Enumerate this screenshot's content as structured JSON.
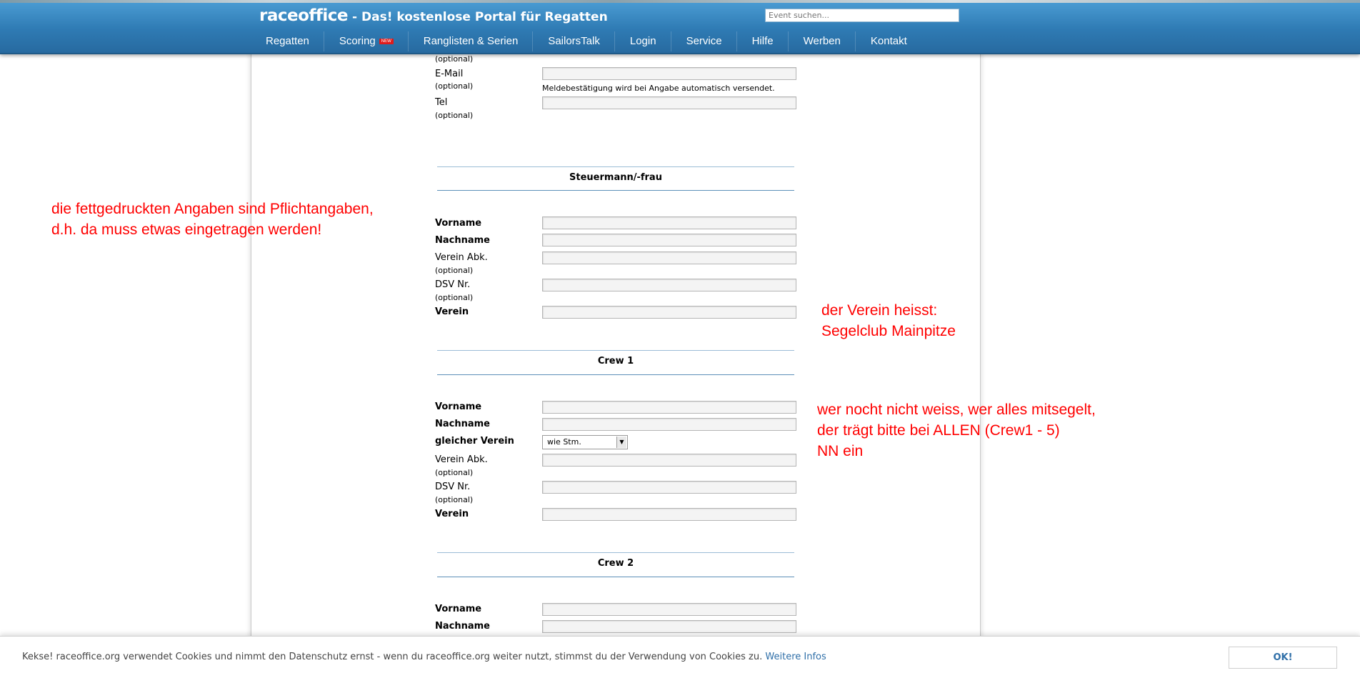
{
  "header": {
    "logo_brand": "raceoffice",
    "logo_tagline": "- Das! kostenlose Portal für Regatten",
    "search_placeholder": "Event suchen...",
    "nav": [
      {
        "label": "Regatten"
      },
      {
        "label": "Scoring",
        "badge": "NEW"
      },
      {
        "label": "Ranglisten & Serien"
      },
      {
        "label": "SailorsTalk"
      },
      {
        "label": "Login"
      },
      {
        "label": "Service"
      },
      {
        "label": "Hilfe"
      },
      {
        "label": "Werben"
      },
      {
        "label": "Kontakt"
      }
    ],
    "colors": {
      "bar": "#2f7bb4",
      "badge": "#e01b1b"
    }
  },
  "contact": {
    "top_optional": "(optional)",
    "email_label": "E-Mail",
    "email_optional": "(optional)",
    "email_hint": "Meldebestätigung wird bei Angabe automatisch versendet.",
    "tel_label": "Tel",
    "tel_optional": "(optional)"
  },
  "helmsman": {
    "title": "Steuermann/-frau",
    "vorname": "Vorname",
    "nachname": "Nachname",
    "verein_abk": "Verein Abk.",
    "verein_abk_optional": "(optional)",
    "dsv": "DSV Nr.",
    "dsv_optional": "(optional)",
    "verein": "Verein"
  },
  "crew1": {
    "title": "Crew 1",
    "vorname": "Vorname",
    "nachname": "Nachname",
    "gleicher_verein": "gleicher Verein",
    "gleicher_verein_value": "wie Stm.",
    "verein_abk": "Verein Abk.",
    "verein_abk_optional": "(optional)",
    "dsv": "DSV Nr.",
    "dsv_optional": "(optional)",
    "verein": "Verein"
  },
  "crew2": {
    "title": "Crew 2",
    "vorname": "Vorname",
    "nachname": "Nachname"
  },
  "annotations": {
    "left_line1": "die fettgedruckten Angaben sind Pflichtangaben,",
    "left_line2": "d.h. da muss etwas eingetragen werden!",
    "verein_line1": "der Verein heisst:",
    "verein_line2": "Segelclub Mainpitze",
    "crew_line1": "wer nocht nicht weiss, wer alles mitsegelt,",
    "crew_line2": "der trägt bitte bei ALLEN (Crew1 - 5)",
    "crew_line3": "NN ein",
    "color": "#ff0000"
  },
  "cookie": {
    "text": "Kekse! raceoffice.org verwendet Cookies und nimmt den Datenschutz ernst - wenn du raceoffice.org weiter nutzt, stimmst du der Verwendung von Cookies zu.",
    "link": "Weitere Infos",
    "ok": "OK!"
  }
}
